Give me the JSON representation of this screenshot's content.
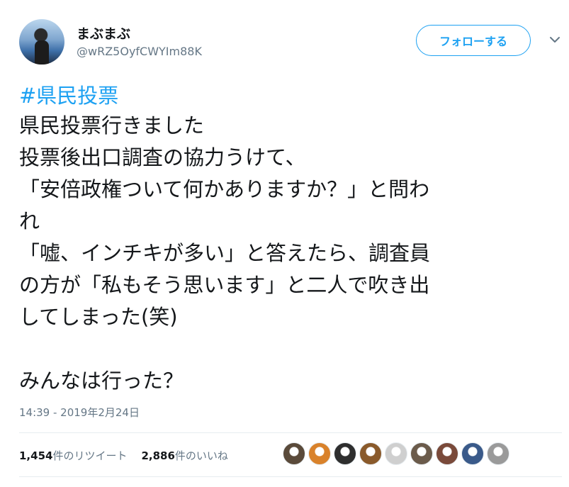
{
  "user": {
    "display_name": "まぶまぶ",
    "handle": "@wRZ5OyfCWYIm88K"
  },
  "follow_button": {
    "label": "フォローする"
  },
  "tweet": {
    "hashtag": "#県民投票",
    "body": "県民投票行きました\n投票後出口調査の協力うけて、\n「安倍政権ついて何かありますか？」と問わ\nれ\n「嘘、インチキが多い」と答えたら、調査員\nの方が「私もそう思います」と二人で吹き出\nしてしまった(笑)\n\nみんなは行った？",
    "timestamp": "14:39 - 2019年2月24日"
  },
  "stats": {
    "retweets_count": "1,454",
    "retweets_label": "件のリツイート",
    "likes_count": "2,886",
    "likes_label": "件のいいね"
  },
  "colors": {
    "accent": "#1da1f2",
    "text": "#14171a",
    "secondary": "#657786",
    "divider": "#e6ecf0"
  },
  "liker_avatars": [
    {
      "color": "#5a4a3a"
    },
    {
      "color": "#d9822b"
    },
    {
      "color": "#2e2e2e"
    },
    {
      "color": "#8a5a2b"
    },
    {
      "color": "#cfcfcf"
    },
    {
      "color": "#6b5b4b"
    },
    {
      "color": "#7a4a3a"
    },
    {
      "color": "#3a5a8a"
    },
    {
      "color": "#9a9a9a"
    }
  ]
}
